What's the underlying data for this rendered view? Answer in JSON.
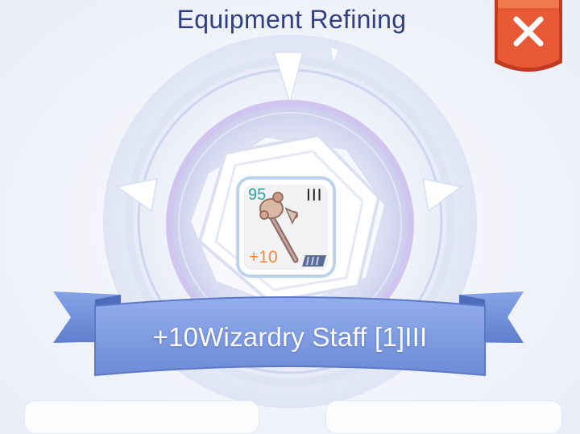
{
  "header": {
    "title": "Equipment Refining"
  },
  "close": {
    "icon": "close-x-icon",
    "color": "#e04a2a"
  },
  "item": {
    "level": "95",
    "slots": "III",
    "refine": "+10",
    "name": "+10Wizardry Staff [1]III",
    "icon": "wizardry-staff-icon"
  },
  "colors": {
    "ribbon": "#7d9be0",
    "ring": "#c9c4ee",
    "title": "#2f3f80"
  }
}
